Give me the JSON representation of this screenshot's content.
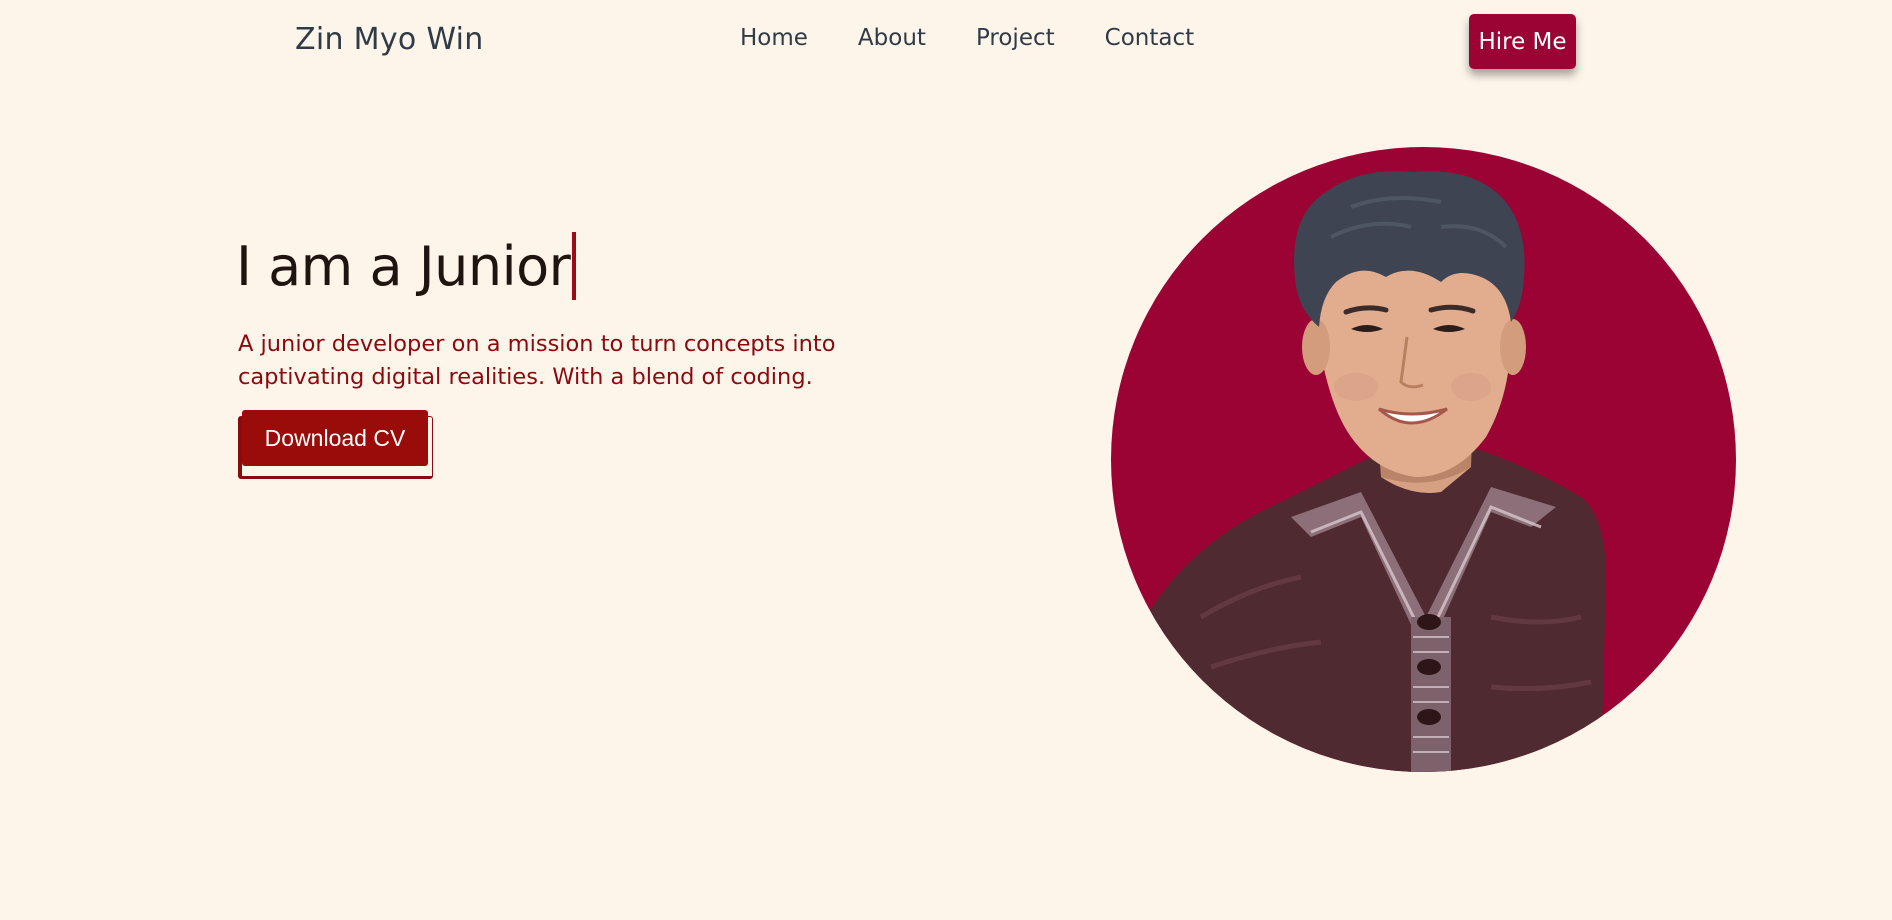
{
  "nav": {
    "brand": "Zin Myo Win",
    "links": [
      "Home",
      "About",
      "Project",
      "Contact"
    ],
    "hire_label": "Hire Me"
  },
  "hero": {
    "title": "I am a Junior",
    "description": "A junior developer on a mission to turn concepts into captivating digital realities. With a blend of coding.",
    "download_label": "Download CV"
  },
  "colors": {
    "background": "#fdf5ea",
    "accent": "#9b0334",
    "button": "#9a0c0a",
    "description_text": "#8a0a10"
  },
  "icons": {
    "profile": "profile-photo"
  }
}
